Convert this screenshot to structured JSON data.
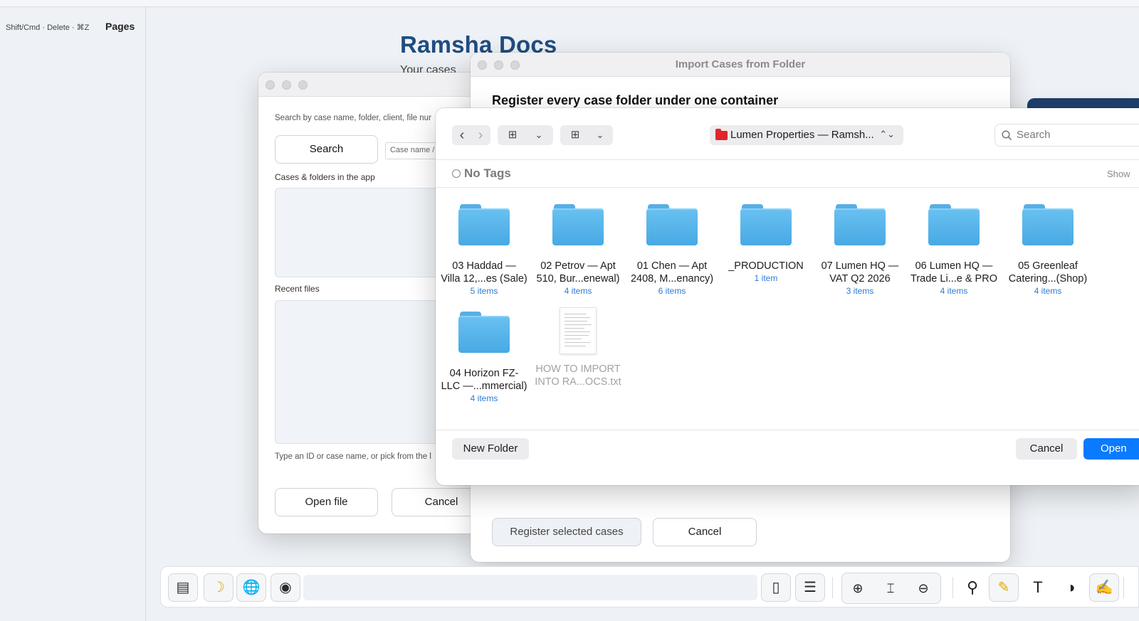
{
  "sidebar": {
    "hint": "Shift/Cmd · Delete · ⌘Z",
    "title": "Pages"
  },
  "app": {
    "title": "Ramsha Docs",
    "subtitle": "Your cases"
  },
  "search_window": {
    "hint": "Search by case name, folder, client, file nur",
    "search_button": "Search",
    "case_placeholder": "Case name /",
    "cases_label": "Cases & folders in the app",
    "recent_label": "Recent files",
    "footer_hint": "Type an ID or case name, or pick from the l",
    "open_button": "Open file",
    "cancel_button": "Cancel"
  },
  "import_window": {
    "title": "Import Cases from Folder",
    "heading": "Register every case folder under one container",
    "register_button": "Register selected cases",
    "cancel_button": "Cancel"
  },
  "picker": {
    "location": "Lumen Properties — Ramsh...",
    "search_placeholder": "Search",
    "tags_label": "No Tags",
    "show_label": "Show",
    "new_folder_button": "New Folder",
    "cancel_button": "Cancel",
    "open_button": "Open",
    "items": [
      {
        "kind": "folder",
        "line1": "03 Haddad —",
        "line2": "Villa 12,...es (Sale)",
        "count": "5 items"
      },
      {
        "kind": "folder",
        "line1": "02 Petrov — Apt",
        "line2": "510, Bur...enewal)",
        "count": "4 items"
      },
      {
        "kind": "folder",
        "line1": "01 Chen — Apt",
        "line2": "2408, M...enancy)",
        "count": "6 items"
      },
      {
        "kind": "folder",
        "line1": "_PRODUCTION",
        "line2": "",
        "count": "1 item"
      },
      {
        "kind": "folder",
        "line1": "07 Lumen HQ —",
        "line2": "VAT Q2 2026",
        "count": "3 items"
      },
      {
        "kind": "folder",
        "line1": "06 Lumen HQ —",
        "line2": "Trade Li...e & PRO",
        "count": "4 items"
      },
      {
        "kind": "folder",
        "line1": "05 Greenleaf",
        "line2": "Catering...(Shop)",
        "count": "4 items"
      },
      {
        "kind": "folder",
        "line1": "04 Horizon FZ-",
        "line2": "LLC —...mmercial)",
        "count": "4 items"
      },
      {
        "kind": "file",
        "line1": "HOW TO IMPORT",
        "line2": "INTO RA...OCS.txt",
        "count": ""
      }
    ]
  },
  "icons": {
    "back": "‹",
    "forward": "›",
    "grid": "⊞",
    "chevron": "⌄",
    "updown": "⌃⌄",
    "magnifier": "⚲",
    "sidebar_toggle": "▤",
    "moon": "☽",
    "globe": "🌐",
    "person": "◉",
    "page": "▯",
    "list": "☰",
    "zoom_in": "⊕",
    "fit": "⌶",
    "zoom_out": "⊖",
    "search": "⚲",
    "highlighter": "✎",
    "text": "T",
    "palette": "◑",
    "sign": "✍"
  },
  "colors": {
    "accent": "#0a7aff",
    "title_blue": "#1f4d80",
    "folder_blue": "#4aaae4",
    "count_blue": "#2c7bd5"
  }
}
